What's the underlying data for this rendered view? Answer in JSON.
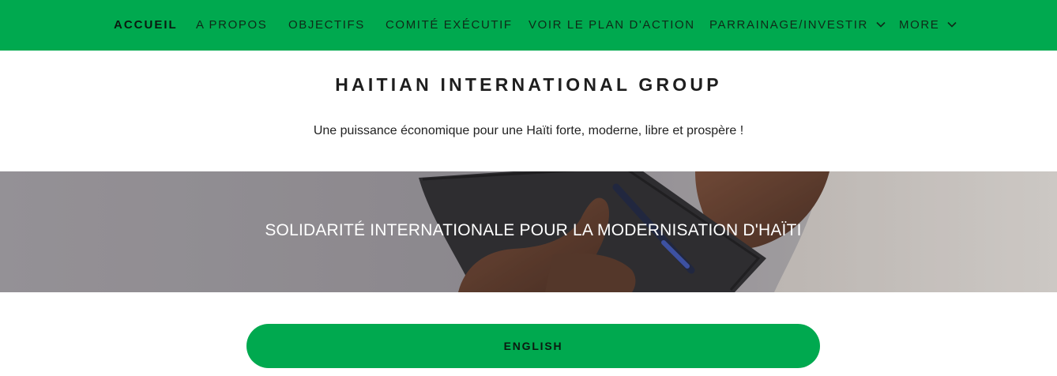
{
  "nav": {
    "items": [
      {
        "label": "ACCUEIL",
        "active": true
      },
      {
        "label": "A PROPOS"
      },
      {
        "label": "OBJECTIFS"
      },
      {
        "label": "COMITÉ EXÉCUTIF"
      },
      {
        "label": "VOIR LE PLAN D'ACTION"
      },
      {
        "label": "PARRAINAGE/INVESTIR",
        "icon": "chevron-down-icon"
      },
      {
        "label": "MORE",
        "icon": "chevron-down-icon"
      }
    ]
  },
  "header": {
    "title": "HAITIAN INTERNATIONAL GROUP",
    "tagline": "Une puissance économique pour une Haïti forte, moderne, libre et prospère !"
  },
  "hero": {
    "text": "SOLIDARITÉ INTERNATIONALE POUR LA MODERNISATION D'HAÏTI"
  },
  "cta": {
    "label": "ENGLISH"
  },
  "colors": {
    "brand_green": "#00a94f",
    "nav_text": "#0f2a18",
    "hero_text": "#ffffff"
  }
}
